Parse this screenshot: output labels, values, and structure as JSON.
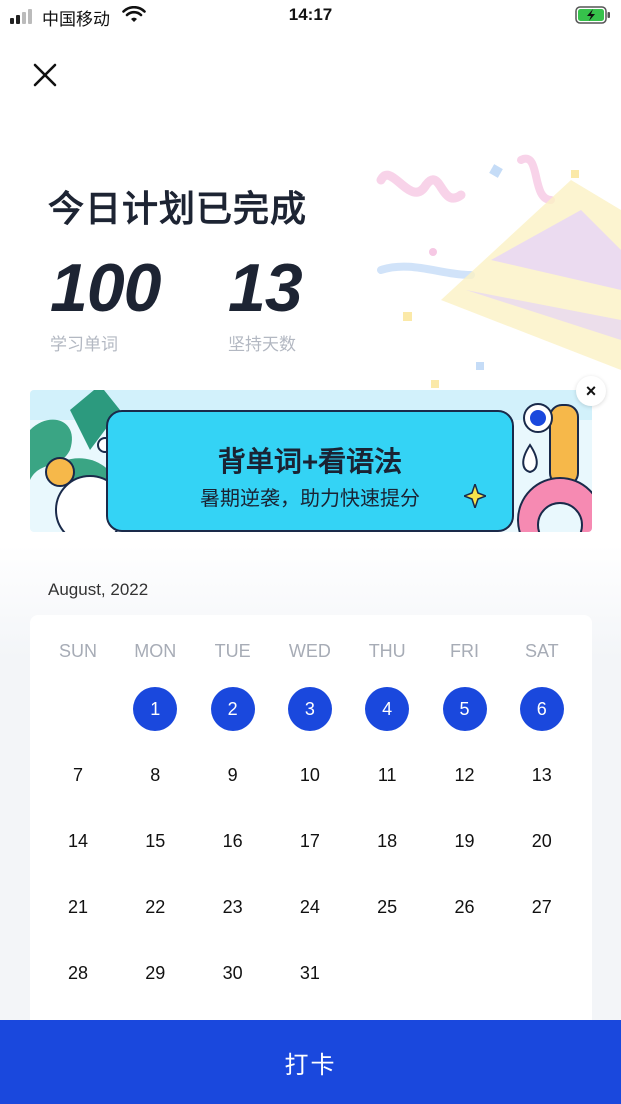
{
  "status_bar": {
    "carrier": "中国移动",
    "time": "14:17"
  },
  "header": {
    "title": "今日计划已完成"
  },
  "stats": {
    "words": {
      "value": "100",
      "label": "学习单词"
    },
    "days": {
      "value": "13",
      "label": "坚持天数"
    }
  },
  "banner": {
    "title": "背单词+看语法",
    "subtitle": "暑期逆袭，助力快速提分",
    "close_label": "×"
  },
  "calendar": {
    "month": "August, 2022",
    "weekdays": [
      "SUN",
      "MON",
      "TUE",
      "WED",
      "THU",
      "FRI",
      "SAT"
    ],
    "days": [
      {
        "day": "1",
        "col": 1,
        "row": 0,
        "done": true
      },
      {
        "day": "2",
        "col": 2,
        "row": 0,
        "done": true
      },
      {
        "day": "3",
        "col": 3,
        "row": 0,
        "done": true
      },
      {
        "day": "4",
        "col": 4,
        "row": 0,
        "done": true
      },
      {
        "day": "5",
        "col": 5,
        "row": 0,
        "done": true
      },
      {
        "day": "6",
        "col": 6,
        "row": 0,
        "done": true
      },
      {
        "day": "7",
        "col": 0,
        "row": 1,
        "done": false
      },
      {
        "day": "8",
        "col": 1,
        "row": 1,
        "done": false
      },
      {
        "day": "9",
        "col": 2,
        "row": 1,
        "done": false
      },
      {
        "day": "10",
        "col": 3,
        "row": 1,
        "done": false
      },
      {
        "day": "11",
        "col": 4,
        "row": 1,
        "done": false
      },
      {
        "day": "12",
        "col": 5,
        "row": 1,
        "done": false
      },
      {
        "day": "13",
        "col": 6,
        "row": 1,
        "done": false
      },
      {
        "day": "14",
        "col": 0,
        "row": 2,
        "done": false
      },
      {
        "day": "15",
        "col": 1,
        "row": 2,
        "done": false
      },
      {
        "day": "16",
        "col": 2,
        "row": 2,
        "done": false
      },
      {
        "day": "17",
        "col": 3,
        "row": 2,
        "done": false
      },
      {
        "day": "18",
        "col": 4,
        "row": 2,
        "done": false
      },
      {
        "day": "19",
        "col": 5,
        "row": 2,
        "done": false
      },
      {
        "day": "20",
        "col": 6,
        "row": 2,
        "done": false
      },
      {
        "day": "21",
        "col": 0,
        "row": 3,
        "done": false
      },
      {
        "day": "22",
        "col": 1,
        "row": 3,
        "done": false
      },
      {
        "day": "23",
        "col": 2,
        "row": 3,
        "done": false
      },
      {
        "day": "24",
        "col": 3,
        "row": 3,
        "done": false
      },
      {
        "day": "25",
        "col": 4,
        "row": 3,
        "done": false
      },
      {
        "day": "26",
        "col": 5,
        "row": 3,
        "done": false
      },
      {
        "day": "27",
        "col": 6,
        "row": 3,
        "done": false
      },
      {
        "day": "28",
        "col": 0,
        "row": 4,
        "done": false
      },
      {
        "day": "29",
        "col": 1,
        "row": 4,
        "done": false
      },
      {
        "day": "30",
        "col": 2,
        "row": 4,
        "done": false
      },
      {
        "day": "31",
        "col": 3,
        "row": 4,
        "done": false
      }
    ]
  },
  "footer": {
    "checkin_label": "打卡"
  },
  "colors": {
    "accent": "#1a48dd",
    "banner_card": "#34d3f5",
    "title_text": "#1d2433",
    "muted_text": "#b3b8c2"
  },
  "icons": {
    "close": "close-icon",
    "signal": "signal-icon",
    "wifi": "wifi-icon",
    "battery": "battery-charging-icon"
  }
}
